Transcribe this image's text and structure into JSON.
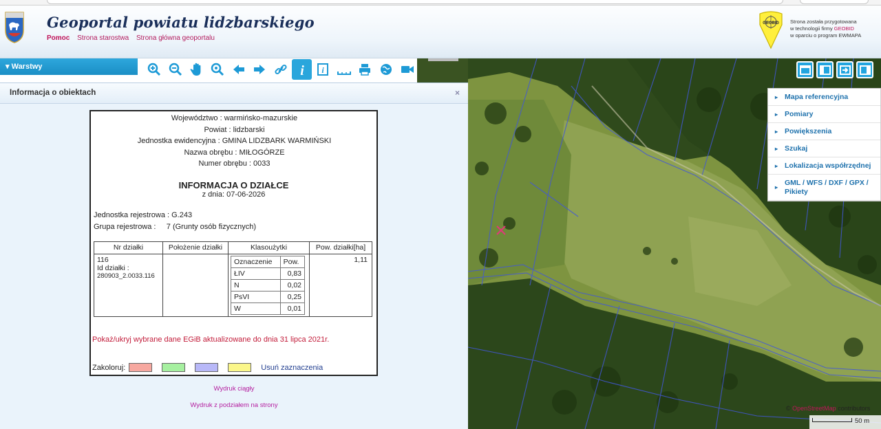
{
  "header": {
    "title": "Geoportal powiatu lidzbarskiego",
    "links": [
      "Pomoc",
      "Strona starostwa",
      "Strona główna geoportalu"
    ],
    "vendor": {
      "logo_text": "GEOBID",
      "line1": "Strona została przygotowana",
      "line2_prefix": "w technologii firmy",
      "line2_brand": "GEOBID",
      "line3": "w oparciu o program EWMAPA"
    }
  },
  "sidebar": {
    "layers_label": "Warstwy"
  },
  "toolbar": {
    "tools": [
      "zoom-in-icon",
      "zoom-out-icon",
      "pan-hand-icon",
      "zoom-window-icon",
      "back-arrow-icon",
      "forward-arrow-icon",
      "link-icon",
      "info-icon",
      "query-icon",
      "measure-icon",
      "print-icon",
      "globe-icon",
      "camera-icon"
    ],
    "active_tool": "info-icon"
  },
  "info_panel": {
    "title": "Informacja o obiektach",
    "close": "×",
    "region": [
      {
        "label": "Województwo",
        "value": "warmińsko-mazurskie"
      },
      {
        "label": "Powiat",
        "value": "lidzbarski"
      },
      {
        "label": "Jednostka ewidencyjna",
        "value": "GMINA LIDZBARK WARMIŃSKI"
      },
      {
        "label": "Nazwa obrębu",
        "value": "MIŁOGÓRZE"
      },
      {
        "label": "Numer obrębu",
        "value": "0033"
      }
    ],
    "doc_title": "INFORMACJA O DZIAŁCE",
    "doc_date": "z dnia: 07-06-2026",
    "registration_unit_label": "Jednostka rejestrowa",
    "registration_unit_value": "G.243",
    "registration_group_label": "Grupa rejestrowa",
    "registration_group_value": "7 (Grunty osób fizycznych)",
    "table": {
      "headers": [
        "Nr działki",
        "Położenie działki",
        "Klasoużytki",
        "Pow. działki[ha]"
      ],
      "parcel_number": "116",
      "parcel_id_label": "Id działki :",
      "parcel_id": "280903_2.0033.116",
      "location": "",
      "area": "1,11",
      "klas_headers": [
        "Oznaczenie",
        "Pow."
      ],
      "klas_rows": [
        {
          "code": "ŁIV",
          "area": "0,83"
        },
        {
          "code": "N",
          "area": "0,02"
        },
        {
          "code": "PsVI",
          "area": "0,25"
        },
        {
          "code": "W",
          "area": "0,01"
        }
      ]
    },
    "show_link": "Pokaż/ukryj wybrane dane EGiB aktualizowane do dnia 31 lipca 2021r.",
    "colorize_label": "Zakoloruj:",
    "swatch_colors": [
      "#f7a8a0",
      "#a6f0a0",
      "#b8b8f8",
      "#fbf78a"
    ],
    "clear_label": "Usuń zaznaczenia",
    "print_continuous": "Wydruk ciągły",
    "print_paged": "Wydruk z podziałem na strony"
  },
  "map": {
    "menu": [
      "Mapa referencyjna",
      "Pomiary",
      "Powiększenia",
      "Szukaj",
      "Lokalizacja współrzędnej",
      "GML / WFS / DXF / GPX / Pikiety"
    ],
    "attribution_prefix": "©",
    "attribution_osm": "OpenStreetMap",
    "attribution_suffix": "contributors",
    "scale_label": "50 m",
    "view_buttons": [
      "layout-full-icon",
      "layout-split-icon",
      "layout-export-icon",
      "layout-side-icon"
    ]
  }
}
